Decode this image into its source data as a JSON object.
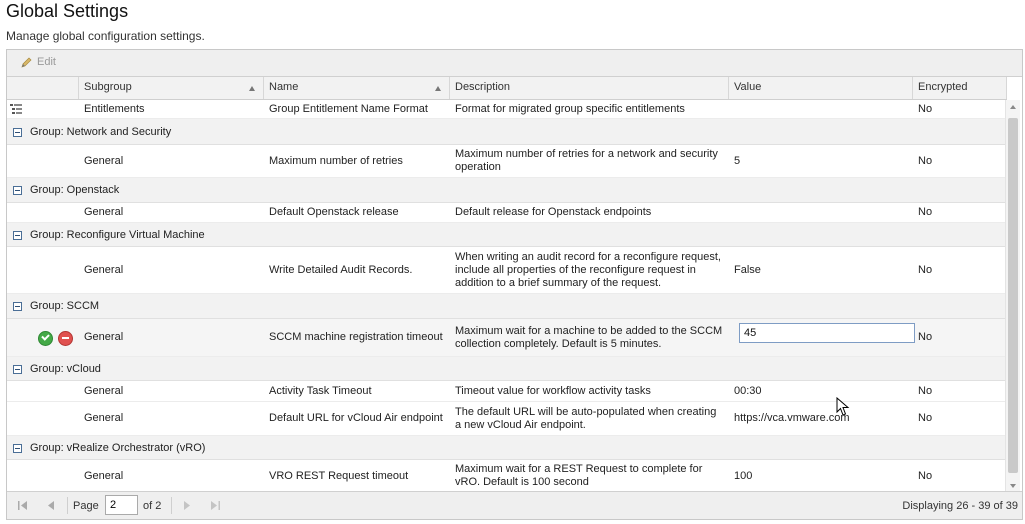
{
  "page": {
    "title": "Global Settings",
    "subtitle": "Manage global configuration settings."
  },
  "toolbar": {
    "edit_label": "Edit"
  },
  "columns": [
    "Subgroup",
    "Name",
    "Description",
    "Value",
    "Encrypted"
  ],
  "rows": [
    {
      "subgroup": "Entitlements",
      "name": "Group Entitlement Name Format",
      "description": "Format for migrated group specific entitlements",
      "value": "",
      "encrypted": "No"
    },
    {
      "group": "Group: Network and Security"
    },
    {
      "subgroup": "General",
      "name": "Maximum number of retries",
      "description": "Maximum number of retries for a network and security operation",
      "value": "5",
      "encrypted": "No"
    },
    {
      "group": "Group: Openstack"
    },
    {
      "subgroup": "General",
      "name": "Default Openstack release",
      "description": "Default release for Openstack endpoints",
      "value": "",
      "encrypted": "No"
    },
    {
      "group": "Group: Reconfigure Virtual Machine"
    },
    {
      "subgroup": "General",
      "name": "Write Detailed Audit Records.",
      "description": "When writing an audit record for a reconfigure request, include all properties of the reconfigure request in addition to a brief summary of the request.",
      "value": "False",
      "encrypted": "No"
    },
    {
      "group": "Group: SCCM"
    },
    {
      "subgroup": "General",
      "name": "SCCM machine registration timeout",
      "description": "Maximum wait for a machine to be added to the SCCM collection completely. Default is 5 minutes.",
      "value": "45",
      "encrypted": "No"
    },
    {
      "group": "Group: vCloud"
    },
    {
      "subgroup": "General",
      "name": "Activity Task Timeout",
      "description": "Timeout value for workflow activity tasks",
      "value": "00:30",
      "encrypted": "No"
    },
    {
      "subgroup": "General",
      "name": "Default URL for vCloud Air endpoint",
      "description": "The default URL will be auto-populated when creating a new vCloud Air endpoint.",
      "value": "https://vca.vmware.com",
      "encrypted": "No"
    },
    {
      "group": "Group: vRealize Orchestrator (vRO)"
    },
    {
      "subgroup": "General",
      "name": "VRO REST Request timeout",
      "description": "Maximum wait for a REST Request to complete for vRO. Default is 100 second",
      "value": "100",
      "encrypted": "No"
    }
  ],
  "pager": {
    "page_label": "Page",
    "page_value": "2",
    "of_label": "of 2",
    "displaying": "Displaying 26 - 39 of 39"
  },
  "colors": {
    "accent": "#4a6e96",
    "ok": "#44a947",
    "cancel": "#e0514f"
  }
}
